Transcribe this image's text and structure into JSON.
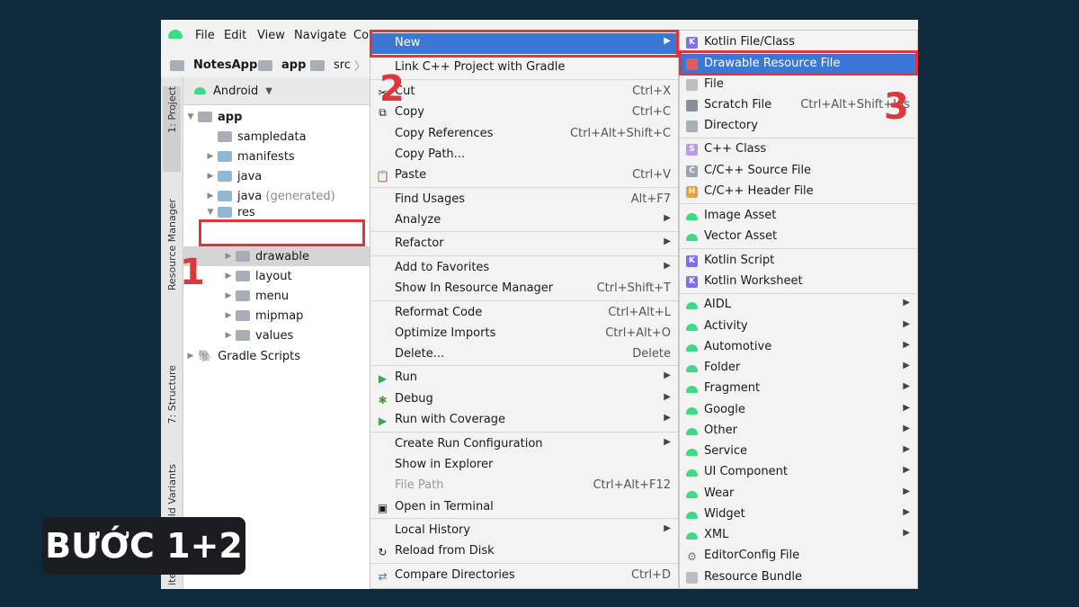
{
  "menubar": {
    "file": "File",
    "edit": "Edit",
    "view": "View",
    "navigate": "Navigate",
    "code": "Co"
  },
  "breadcrumb": {
    "project": "NotesApp",
    "module": "app",
    "folder": "src"
  },
  "sidebar": {
    "project": "1: Project",
    "resource_manager": "Resource Manager",
    "structure": "7: Structure",
    "build_variants": "Build Variants",
    "favorites": "ites"
  },
  "project_view": {
    "mode": "Android"
  },
  "tree": [
    {
      "label": "app",
      "bold": true
    },
    {
      "label": "sampledata"
    },
    {
      "label": "manifests"
    },
    {
      "label": "java"
    },
    {
      "label": "java",
      "suffix": "(generated)"
    },
    {
      "label": "res"
    },
    {
      "label": "drawable"
    },
    {
      "label": "layout"
    },
    {
      "label": "menu"
    },
    {
      "label": "mipmap"
    },
    {
      "label": "values"
    },
    {
      "label": "Gradle Scripts"
    }
  ],
  "context_menu": [
    {
      "label": "New",
      "shortcut": "",
      "submenu": true,
      "highlight": true
    },
    {
      "label": "Link C++ Project with Gradle",
      "shortcut": ""
    },
    {
      "label": "Cut",
      "shortcut": "Ctrl+X",
      "icon": "✂"
    },
    {
      "label": "Copy",
      "shortcut": "Ctrl+C",
      "icon": "⧉"
    },
    {
      "label": "Copy References",
      "shortcut": "Ctrl+Alt+Shift+C"
    },
    {
      "label": "Copy Path...",
      "shortcut": ""
    },
    {
      "label": "Paste",
      "shortcut": "Ctrl+V",
      "icon": "📋"
    },
    {
      "label": "Find Usages",
      "shortcut": "Alt+F7"
    },
    {
      "label": "Analyze",
      "shortcut": "",
      "submenu": true
    },
    {
      "label": "Refactor",
      "shortcut": "",
      "submenu": true
    },
    {
      "label": "Add to Favorites",
      "shortcut": "",
      "submenu": true
    },
    {
      "label": "Show In Resource Manager",
      "shortcut": "Ctrl+Shift+T"
    },
    {
      "label": "Reformat Code",
      "shortcut": "Ctrl+Alt+L"
    },
    {
      "label": "Optimize Imports",
      "shortcut": "Ctrl+Alt+O"
    },
    {
      "label": "Delete...",
      "shortcut": "Delete"
    },
    {
      "label": "Run",
      "shortcut": "",
      "submenu": true,
      "icon": "▶"
    },
    {
      "label": "Debug",
      "shortcut": "",
      "submenu": true,
      "icon": "✱"
    },
    {
      "label": "Run with Coverage",
      "shortcut": "",
      "submenu": true,
      "icon": "▶"
    },
    {
      "label": "Create Run Configuration",
      "shortcut": "",
      "submenu": true
    },
    {
      "label": "Show in Explorer",
      "shortcut": ""
    },
    {
      "label": "File Path",
      "shortcut": "Ctrl+Alt+F12",
      "disabled": true
    },
    {
      "label": "Open in Terminal",
      "shortcut": "",
      "icon": "▣"
    },
    {
      "label": "Local History",
      "shortcut": "",
      "submenu": true
    },
    {
      "label": "Reload from Disk",
      "shortcut": "",
      "icon": "↻"
    },
    {
      "label": "Compare Directories",
      "shortcut": "Ctrl+D",
      "icon": "⇄"
    }
  ],
  "new_submenu": [
    {
      "label": "Kotlin File/Class",
      "shortcut": ""
    },
    {
      "label": "Drawable Resource File",
      "shortcut": "",
      "highlight": true
    },
    {
      "label": "File",
      "shortcut": ""
    },
    {
      "label": "Scratch File",
      "shortcut": "Ctrl+Alt+Shift+Ins"
    },
    {
      "label": "Directory",
      "shortcut": ""
    },
    {
      "label": "C++ Class",
      "shortcut": ""
    },
    {
      "label": "C/C++ Source File",
      "shortcut": ""
    },
    {
      "label": "C/C++ Header File",
      "shortcut": ""
    },
    {
      "label": "Image Asset",
      "shortcut": ""
    },
    {
      "label": "Vector Asset",
      "shortcut": ""
    },
    {
      "label": "Kotlin Script",
      "shortcut": ""
    },
    {
      "label": "Kotlin Worksheet",
      "shortcut": ""
    },
    {
      "label": "AIDL",
      "submenu": true
    },
    {
      "label": "Activity",
      "submenu": true
    },
    {
      "label": "Automotive",
      "submenu": true
    },
    {
      "label": "Folder",
      "submenu": true
    },
    {
      "label": "Fragment",
      "submenu": true
    },
    {
      "label": "Google",
      "submenu": true
    },
    {
      "label": "Other",
      "submenu": true
    },
    {
      "label": "Service",
      "submenu": true
    },
    {
      "label": "UI Component",
      "submenu": true
    },
    {
      "label": "Wear",
      "submenu": true
    },
    {
      "label": "Widget",
      "submenu": true
    },
    {
      "label": "XML",
      "submenu": true
    },
    {
      "label": "EditorConfig File",
      "shortcut": ""
    },
    {
      "label": "Resource Bundle",
      "shortcut": ""
    }
  ],
  "step_labels": {
    "one": "1",
    "two": "2",
    "three": "3"
  },
  "badge": "BƯỚC 1+2",
  "colors": {
    "background": "#0f2a3a",
    "highlight": "#3a77d6",
    "annotation_red": "#e0353b",
    "android_green": "#3ddc84"
  }
}
